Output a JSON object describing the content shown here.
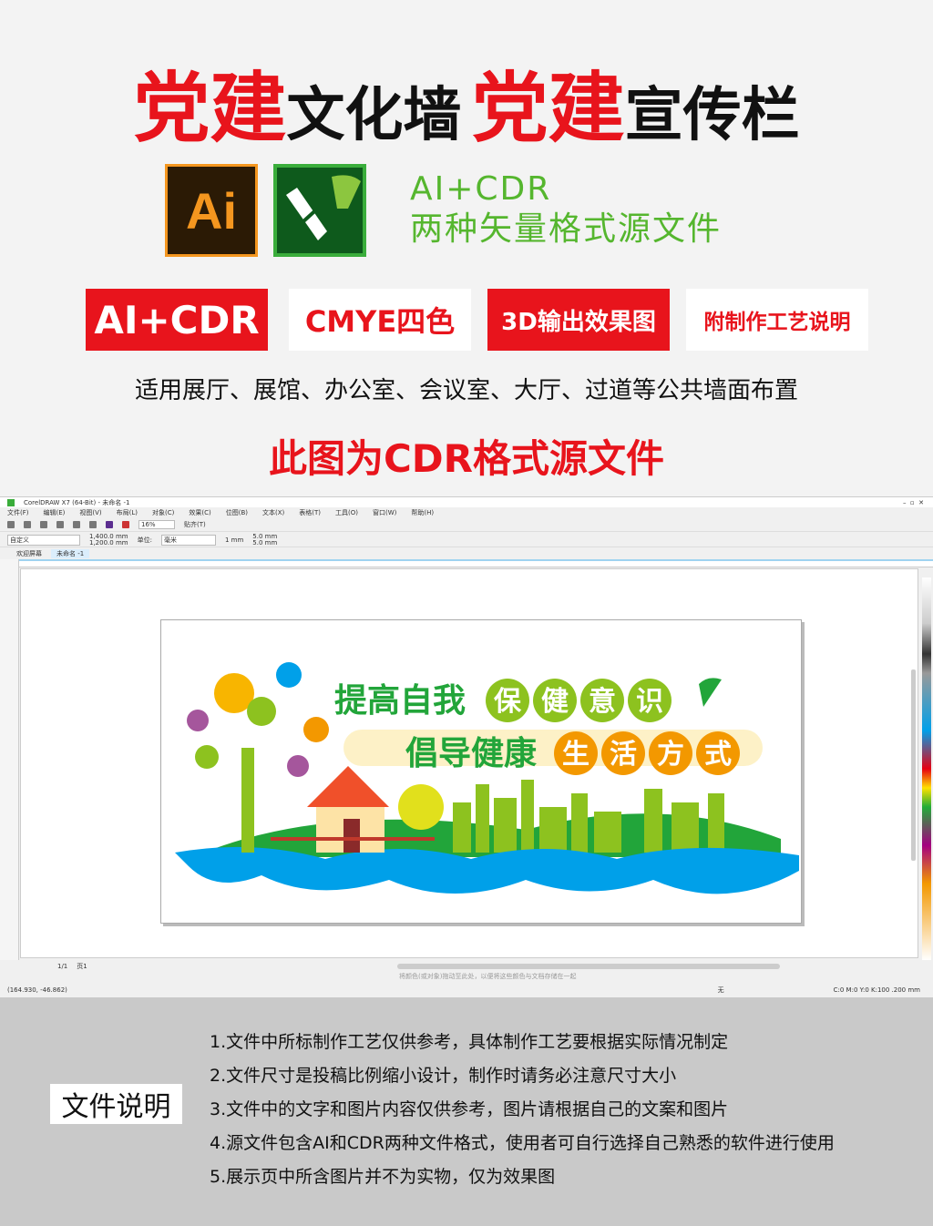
{
  "title": {
    "p1": "党建",
    "p2": "文化墙",
    "p3": "党建",
    "p4": "宣传栏"
  },
  "icons": {
    "ai_label": "Ai",
    "ai": "adobe-illustrator-icon",
    "cdr": "coreldraw-icon"
  },
  "formats": {
    "line1": "AI+CDR",
    "line2": "两种矢量格式源文件"
  },
  "badges": [
    "AI+CDR",
    "CMYE四色",
    "3D输出效果图",
    "附制作工艺说明"
  ],
  "usage": "适用展厅、展馆、办公室、会议室、大厅、过道等公共墙面布置",
  "cdr_note": "此图为CDR格式源文件",
  "corel": {
    "title": "CorelDRAW X7 (64-Bit) - 未命名 -1",
    "menu": [
      "文件(F)",
      "编辑(E)",
      "视图(V)",
      "布局(L)",
      "对象(C)",
      "效果(C)",
      "位图(B)",
      "文本(X)",
      "表格(T)",
      "工具(O)",
      "窗口(W)",
      "帮助(H)"
    ],
    "zoom": "16%",
    "snap": "贴齐(T)",
    "preset": "自定义",
    "width": "1,400.0 mm",
    "height": "1,200.0 mm",
    "unit_label": "单位:",
    "unit": "毫米",
    "nudge": "1 mm",
    "dup_x": "5.0 mm",
    "dup_y": "5.0 mm",
    "tabs": [
      "欢迎屏幕",
      "未命名 -1"
    ],
    "page_nav": "1/1",
    "page_tab": "页1",
    "hint": "将颜色(或对象)拖动至此处，以便将这些颜色与文档存储在一起",
    "coords": "(164.930, -46.862)",
    "fill_label": "无",
    "color_info": "C:0 M:0 Y:0 K:100 .200 mm"
  },
  "artwork": {
    "line1": "提高自我",
    "circles1": [
      "保",
      "健",
      "意",
      "识"
    ],
    "line2": "倡导健康",
    "circles2": [
      "生",
      "活",
      "方",
      "式"
    ]
  },
  "docs": {
    "button": "文件说明",
    "items": [
      "1.文件中所标制作工艺仅供参考，具体制作工艺要根据实际情况制定",
      "2.文件尺寸是投稿比例缩小设计，制作时请务必注意尺寸大小",
      "3.文件中的文字和图片内容仅供参考，图片请根据自己的文案和图片",
      "4.源文件包含AI和CDR两种文件格式，使用者可自行选择自己熟悉的软件进行使用",
      "5.展示页中所含图片并不为实物，仅为效果图"
    ]
  },
  "colors": {
    "red": "#e8141c",
    "green": "#55b62e",
    "orange": "#f39800"
  }
}
